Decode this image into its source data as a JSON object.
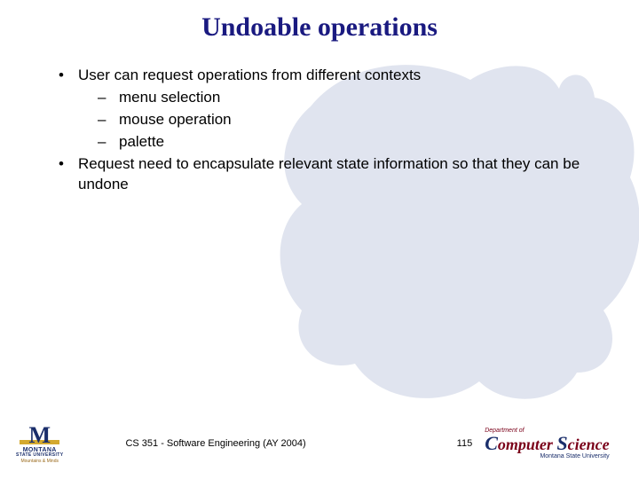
{
  "title": "Undoable operations",
  "bullets": {
    "b1": "User can request operations from different contexts",
    "b1a": "menu selection",
    "b1b": "mouse operation",
    "b1c": "palette",
    "b2": "Request need to encapsulate relevant state information so that they can be undone"
  },
  "footer": {
    "course": "CS 351 - Software Engineering (AY 2004)",
    "page": "115"
  },
  "logos": {
    "left_name": "MONTANA",
    "left_sub": "STATE UNIVERSITY",
    "left_tag": "Mountains & Minds",
    "right_dept": "Department of",
    "right_c": "C",
    "right_omputer": "omputer ",
    "right_s": "S",
    "right_cience": "cience",
    "right_sub": "Montana State University"
  }
}
